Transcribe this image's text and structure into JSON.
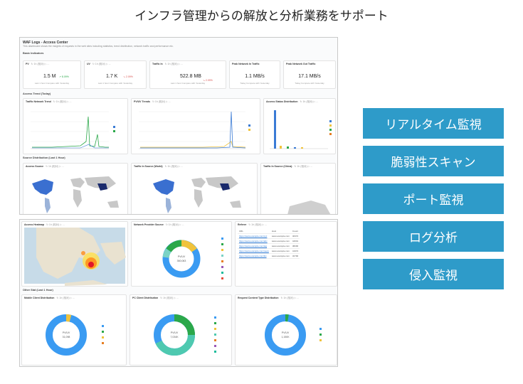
{
  "title": "インフラ管理からの解放と分析業務をサポート",
  "features": [
    "リアルタイム監視",
    "脆弱性スキャン",
    "ポート監視",
    "ログ分析",
    "侵入監視"
  ],
  "dashboard": {
    "header_title": "WAF Logs - Access Center",
    "header_desc": "This dashboard shows the insights of requests in the web sites including statistics, trend distribution, network traffic and performance etc.",
    "sections": {
      "basic": "Basic Indicators",
      "trend": "Access Trend (Today)",
      "source": "Source Distribution (Last 1 Hour)",
      "other": "Other Stat (Last 1 Hour)"
    },
    "query_hint": "↻ 1h (相对) ▷ ...",
    "kpis": [
      {
        "label": "PV",
        "value": "1.5 M",
        "delta": "↗ 8.09%",
        "sub": "Last 1 hour Compare with Yesterday"
      },
      {
        "label": "UV",
        "value": "1.7 K",
        "delta": "↘ 2.09%",
        "sub": "Last 1 hour Compare with Yesterday"
      },
      {
        "label": "Traffic In",
        "value": "522.8 MB",
        "delta": "↘ 2.09%",
        "sub": "Last 1 hour Compare with Yesterday"
      },
      {
        "label": "Peak Network In Traffic",
        "value": "1.1 MB/s",
        "delta": "",
        "sub": "Today Compare with Yesterday"
      },
      {
        "label": "Peak Network Out Traffic",
        "value": "17.1 MB/s",
        "delta": "",
        "sub": "Today Compare with Yesterday"
      }
    ],
    "trend_cards": [
      "Traffic Network Trend",
      "PV/UV Trends",
      "Access Status Distribution"
    ],
    "map_cards": [
      "Access Source",
      "Traffic In Source (World)",
      "Traffic In Source (China)"
    ],
    "bottom_cards": [
      "Access Heatmap",
      "Network Provider Source",
      "Referer"
    ],
    "other_cards": [
      "Mobile Client Distribution",
      "PC Client Distribution",
      "Request Content Type Distribution"
    ],
    "referer_table": {
      "headers": [
        "URL",
        "Host",
        "Count"
      ],
      "rows": [
        [
          "https://www.example.com/xyz",
          "www.example.com",
          "46372"
        ],
        [
          "https://www.example.com/abc",
          "www.example.com",
          "44601"
        ],
        [
          "https://www.example.com/tag",
          "www.example.com",
          "38290"
        ],
        [
          "https://www.example.com/news",
          "www.example.com",
          "41972"
        ],
        [
          "https://www.example.com/list",
          "www.example.com",
          "32790"
        ]
      ]
    },
    "donut_center": "PV/UV"
  }
}
